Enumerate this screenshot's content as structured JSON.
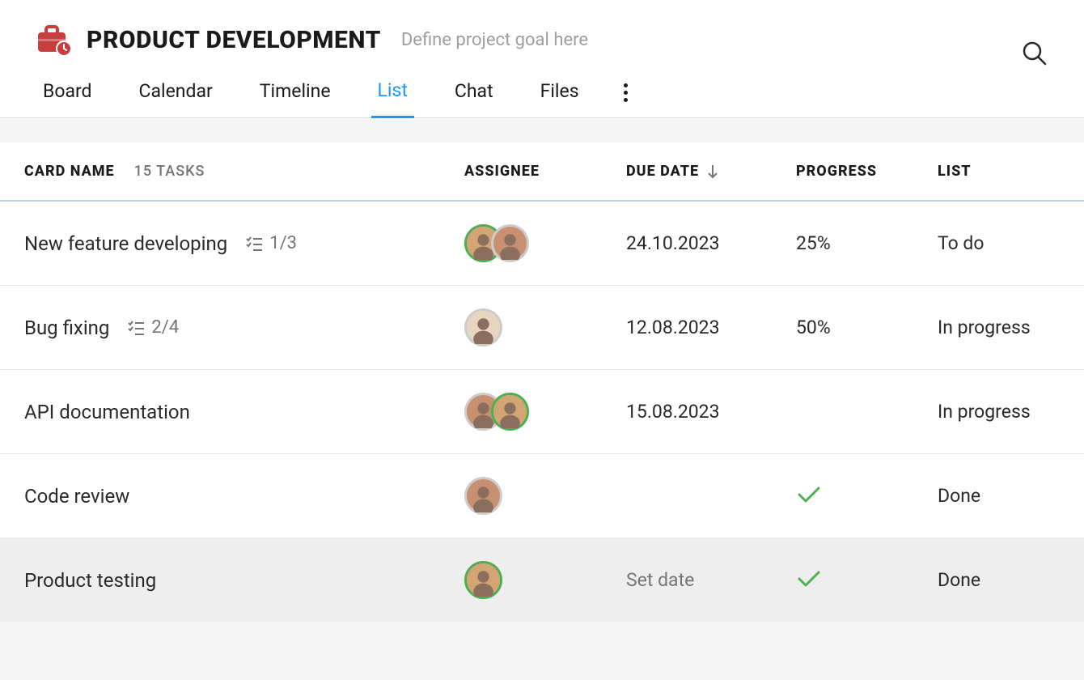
{
  "header": {
    "title": "PRODUCT DEVELOPMENT",
    "subtitle": "Define project goal here"
  },
  "tabs": {
    "items": [
      {
        "label": "Board"
      },
      {
        "label": "Calendar"
      },
      {
        "label": "Timeline"
      },
      {
        "label": "List"
      },
      {
        "label": "Chat"
      },
      {
        "label": "Files"
      }
    ],
    "active_index": 3
  },
  "table": {
    "columns": {
      "card_name": "CARD NAME",
      "tasks_count": "15 TASKS",
      "assignee": "ASSIGNEE",
      "due_date": "DUE DATE",
      "progress": "PROGRESS",
      "list": "LIST"
    },
    "rows": [
      {
        "name": "New feature developing",
        "subtask": "1/3",
        "assignees": [
          {
            "ring": true,
            "bg": "#d4a574"
          },
          {
            "ring": false,
            "bg": "#c89070"
          }
        ],
        "due": "24.10.2023",
        "progress": "25%",
        "list": "To do",
        "done": false
      },
      {
        "name": "Bug fixing",
        "subtask": "2/4",
        "assignees": [
          {
            "ring": false,
            "bg": "#e8d5c0"
          }
        ],
        "due": "12.08.2023",
        "progress": "50%",
        "list": "In progress",
        "done": false
      },
      {
        "name": "API documentation",
        "subtask": "",
        "assignees": [
          {
            "ring": false,
            "bg": "#c89070"
          },
          {
            "ring": true,
            "bg": "#d4a574"
          }
        ],
        "due": "15.08.2023",
        "progress": "",
        "list": "In progress",
        "done": false
      },
      {
        "name": "Code review",
        "subtask": "",
        "assignees": [
          {
            "ring": false,
            "bg": "#c89070"
          }
        ],
        "due": "",
        "progress": "",
        "list": "Done",
        "done": true
      },
      {
        "name": "Product testing",
        "subtask": "",
        "assignees": [
          {
            "ring": true,
            "bg": "#d4a574"
          }
        ],
        "due": "Set date",
        "due_muted": true,
        "progress": "",
        "list": "Done",
        "done": true,
        "hover": true
      }
    ]
  }
}
